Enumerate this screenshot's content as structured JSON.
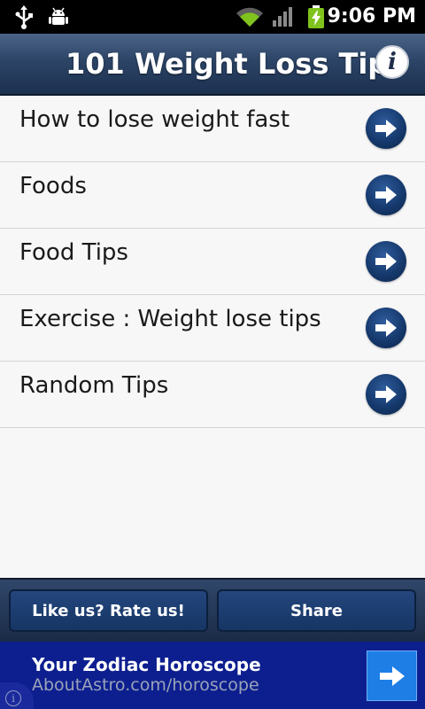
{
  "status_bar": {
    "time": "9:06 PM",
    "icons": [
      "usb-icon",
      "android-debug-icon",
      "wifi-icon",
      "signal-icon",
      "battery-charging-icon"
    ]
  },
  "header": {
    "title": "101 Weight Loss Tips",
    "info_icon": "info-icon"
  },
  "menu": {
    "items": [
      {
        "label": "How to lose weight fast"
      },
      {
        "label": "Foods"
      },
      {
        "label": "Food Tips"
      },
      {
        "label": "Exercise : Weight lose tips"
      },
      {
        "label": "Random Tips"
      }
    ]
  },
  "footer": {
    "rate_label": "Like us? Rate us!",
    "share_label": "Share"
  },
  "ad": {
    "title": "Your Zodiac Horoscope",
    "url": "AboutAstro.com/horoscope"
  },
  "colors": {
    "header": "#2c4466",
    "arrow_button": "#163a6e",
    "ad_background": "#0d1f8f",
    "ad_arrow": "#1e7ee6"
  }
}
